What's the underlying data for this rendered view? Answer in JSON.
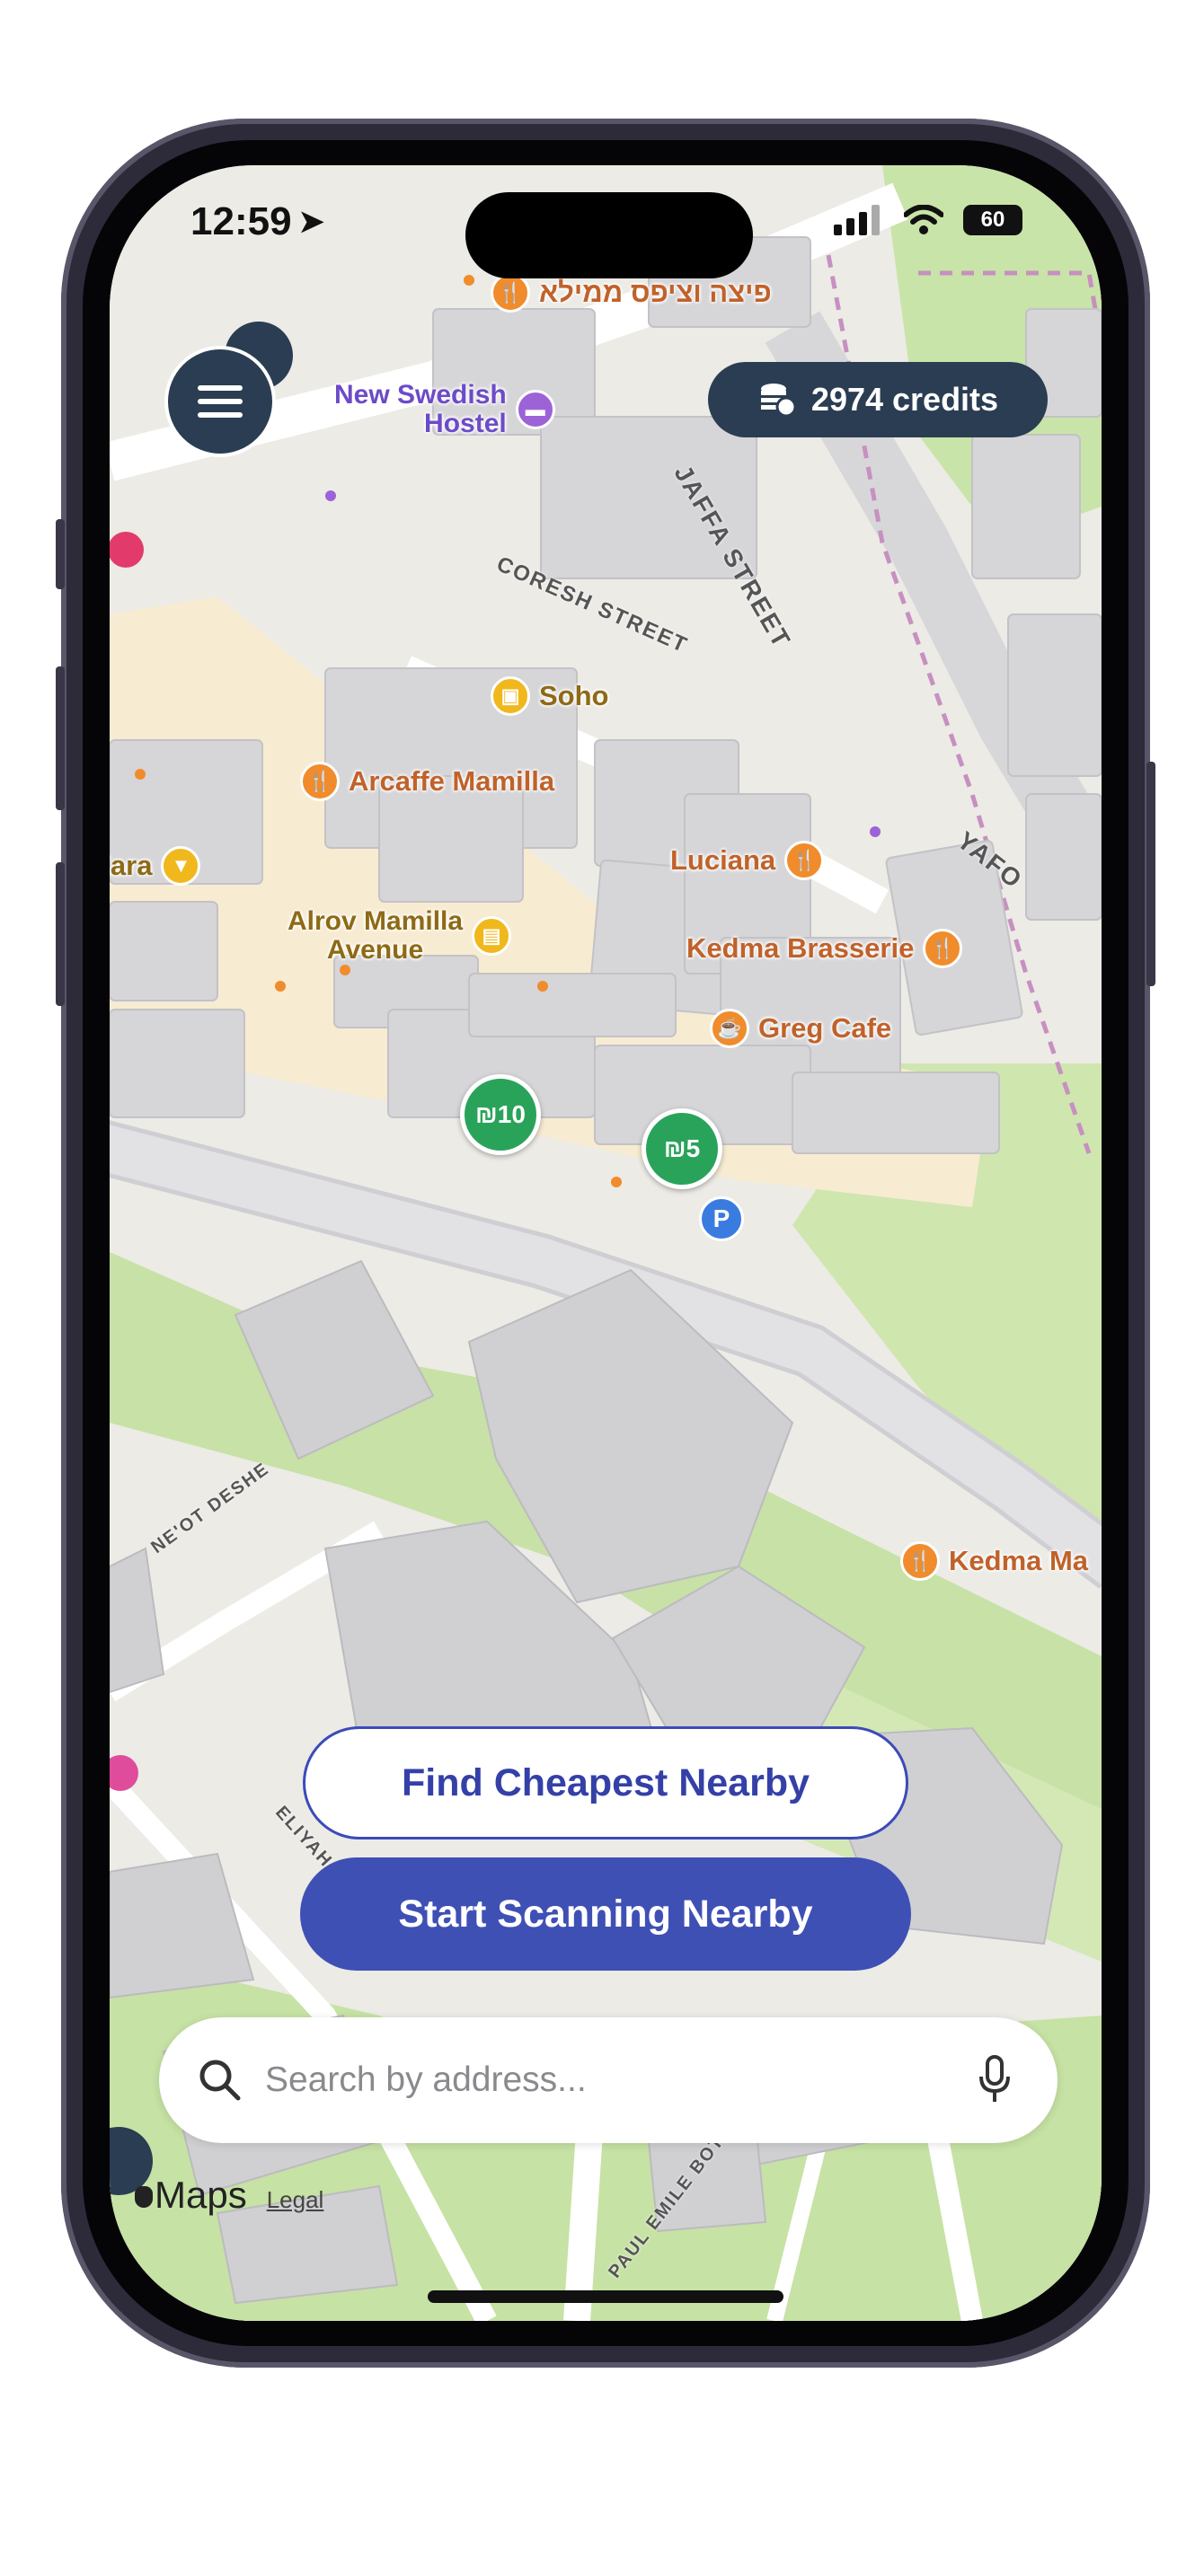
{
  "status_bar": {
    "time": "12:59",
    "battery": "60"
  },
  "header": {
    "menu_icon": "hamburger-icon",
    "credits_icon": "coins-icon",
    "credits_label": "2974 credits"
  },
  "map": {
    "pois": [
      {
        "label": "פיצה וציפס ממילא",
        "icon": "fork-knife-icon",
        "category": "food"
      },
      {
        "label": "New Swedish",
        "label2": "Hostel",
        "icon": "bed-icon",
        "category": "hotel"
      },
      {
        "label": "Soho",
        "icon": "bag-icon",
        "category": "shop"
      },
      {
        "label": "Arcaffe Mamilla",
        "icon": "fork-knife-icon",
        "category": "food"
      },
      {
        "label": "Zara",
        "icon": "shirt-icon",
        "category": "shop"
      },
      {
        "label": "Luciana",
        "icon": "fork-knife-icon",
        "category": "food"
      },
      {
        "label": "Alrov Mamilla",
        "label2": "Avenue",
        "icon": "store-icon",
        "category": "shop"
      },
      {
        "label": "Kedma Brasserie",
        "icon": "fork-knife-icon",
        "category": "food"
      },
      {
        "label": "Greg Cafe",
        "icon": "cup-icon",
        "category": "food"
      },
      {
        "label": "Kedma Ma",
        "icon": "fork-knife-icon",
        "category": "food"
      }
    ],
    "streets": [
      "JAFFA STREET",
      "CORESH STREET",
      "YAFO",
      "NE'OT DESHE",
      "ELIYAH",
      "PAUL EMILE BOTT"
    ],
    "price_pins": [
      {
        "label": "₪10"
      },
      {
        "label": "₪5"
      }
    ],
    "parking_label": "P"
  },
  "actions": {
    "find_cheapest_label": "Find Cheapest Nearby",
    "start_scanning_label": "Start Scanning Nearby"
  },
  "search": {
    "placeholder": "Search by address...",
    "search_icon": "search-icon",
    "mic_icon": "microphone-icon"
  },
  "attribution": {
    "maps_label": "Maps",
    "legal_label": "Legal"
  },
  "colors": {
    "brand": "#3f50b5",
    "header_bg": "#2a3d52",
    "price_pin": "#2aa35a",
    "food": "#f08c2c",
    "shop": "#f0b81c"
  }
}
